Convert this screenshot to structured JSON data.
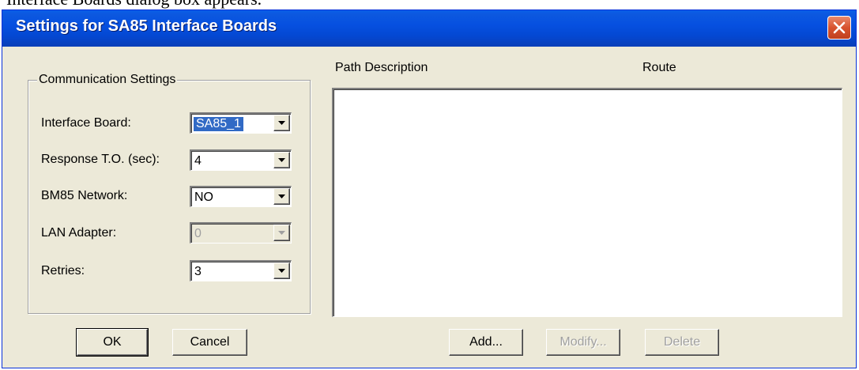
{
  "document": {
    "caption": "Interface Boards dialog box appears."
  },
  "window": {
    "title": "Settings for SA85 Interface Boards"
  },
  "communication_settings": {
    "legend": "Communication Settings",
    "fields": [
      {
        "label": "Interface Board:",
        "value": "SA85_1",
        "enabled": true,
        "selected": true
      },
      {
        "label": "Response T.O. (sec):",
        "value": "4",
        "enabled": true
      },
      {
        "label": "BM85 Network:",
        "value": "NO",
        "enabled": true
      },
      {
        "label": "LAN Adapter:",
        "value": "0",
        "enabled": false
      },
      {
        "label": "Retries:",
        "value": "3",
        "enabled": true
      }
    ]
  },
  "paths": {
    "columns": [
      "Path Description",
      "Route"
    ],
    "rows": []
  },
  "buttons": {
    "ok": "OK",
    "cancel": "Cancel",
    "add": "Add...",
    "modify": "Modify...",
    "delete": "Delete"
  },
  "colors": {
    "titlebar": "#0650e0",
    "dialog_bg": "#ece9d8",
    "selection": "#316ac5"
  }
}
